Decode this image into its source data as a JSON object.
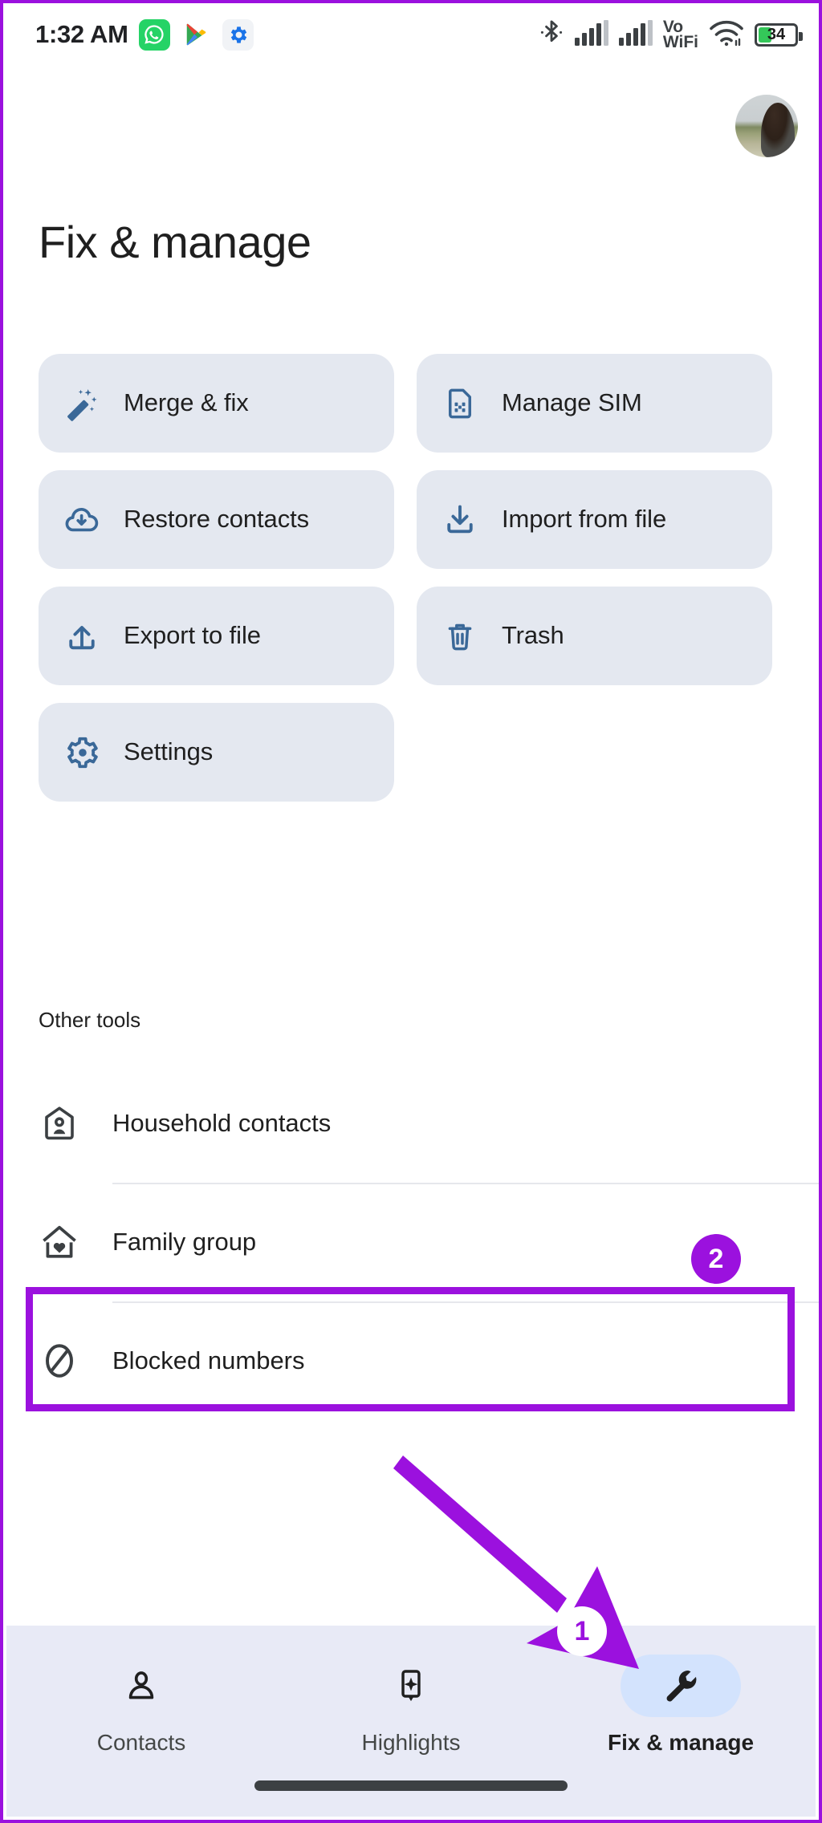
{
  "status_bar": {
    "time": "1:32 AM",
    "notification_icons": [
      "whatsapp-icon",
      "google-play-services-icon",
      "settings-gear-icon"
    ],
    "right_icons": [
      "bluetooth-icon",
      "signal-sim1-icon",
      "signal-sim2-icon",
      "vowifi-indicator",
      "wifi-icon",
      "battery-icon"
    ],
    "vowifi_line1": "Vo",
    "vowifi_line2": "WiFi",
    "battery_percent": "34"
  },
  "header": {
    "title": "Fix & manage",
    "avatar_name": "profile-avatar"
  },
  "tiles": [
    {
      "label": "Merge & fix",
      "icon": "magic-wand-icon"
    },
    {
      "label": "Manage SIM",
      "icon": "sim-card-icon"
    },
    {
      "label": "Restore contacts",
      "icon": "cloud-download-icon"
    },
    {
      "label": "Import from file",
      "icon": "download-icon"
    },
    {
      "label": "Export to file",
      "icon": "upload-icon"
    },
    {
      "label": "Trash",
      "icon": "trash-icon"
    },
    {
      "label": "Settings",
      "icon": "gear-icon"
    }
  ],
  "other_tools": {
    "section_label": "Other tools",
    "items": [
      {
        "label": "Household contacts",
        "icon": "house-person-icon"
      },
      {
        "label": "Family group",
        "icon": "house-heart-icon"
      },
      {
        "label": "Blocked numbers",
        "icon": "block-icon"
      }
    ]
  },
  "annotations": {
    "accent_color": "#9b11de",
    "badge_1": "1",
    "badge_2": "2",
    "arrow": "arrow-pointing-to-fix-and-manage-tab",
    "highlight_target": "Blocked numbers"
  },
  "bottom_nav": {
    "items": [
      {
        "label": "Contacts",
        "icon": "person-icon",
        "active": false
      },
      {
        "label": "Highlights",
        "icon": "sparkle-phone-icon",
        "active": false
      },
      {
        "label": "Fix & manage",
        "icon": "wrench-icon",
        "active": true
      }
    ]
  },
  "colors": {
    "tile_background": "#e4e8f0",
    "tile_icon": "#3a6898",
    "nav_background": "#e8eaf6",
    "nav_active_pill": "#d3e3fd",
    "accent_purple": "#9b11de",
    "battery_green": "#34C759"
  }
}
